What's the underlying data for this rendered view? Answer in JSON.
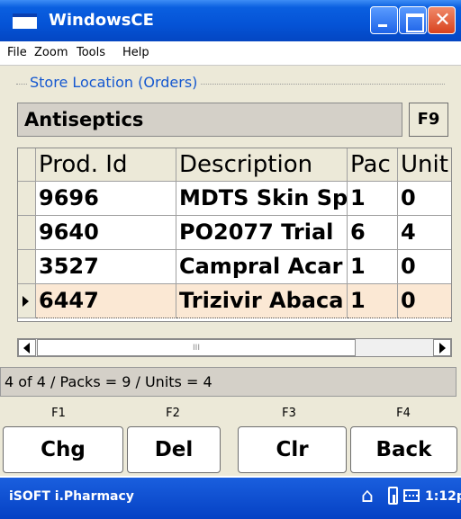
{
  "window": {
    "title": "WindowsCE"
  },
  "menu": [
    "File",
    "Zoom",
    "Tools",
    "Help"
  ],
  "store": {
    "legend": "Store Location (Orders)",
    "location": "Antiseptics",
    "f9_label": "F9"
  },
  "grid": {
    "columns": [
      "Prod. Id",
      "Description",
      "Pac",
      "Unit"
    ],
    "rows": [
      [
        "9696",
        "MDTS Skin Sp",
        "1",
        "0"
      ],
      [
        "9640",
        "PO2077 Trial",
        "6",
        "4"
      ],
      [
        "3527",
        "Campral Acar",
        "1",
        "0"
      ],
      [
        "6447",
        "Trizivir Abaca",
        "1",
        "0"
      ]
    ],
    "selected_row": 3
  },
  "scrollbar": {
    "thumb_glyph": "III"
  },
  "status": "4 of 4 / Packs = 9 / Units = 4",
  "fkeys": [
    {
      "key": "F1",
      "label": "Chg"
    },
    {
      "key": "F2",
      "label": "Del"
    },
    {
      "key": "F3",
      "label": "Clr"
    },
    {
      "key": "F4",
      "label": "Back"
    }
  ],
  "taskbar": {
    "app_name": "iSOFT i.Pharmacy",
    "home_glyph": "⌂",
    "clock": "1:12p"
  },
  "icons": [
    "app-icon",
    "minimize-icon",
    "maximize-icon",
    "close-icon",
    "home-icon",
    "battery-icon",
    "keyboard-icon"
  ]
}
